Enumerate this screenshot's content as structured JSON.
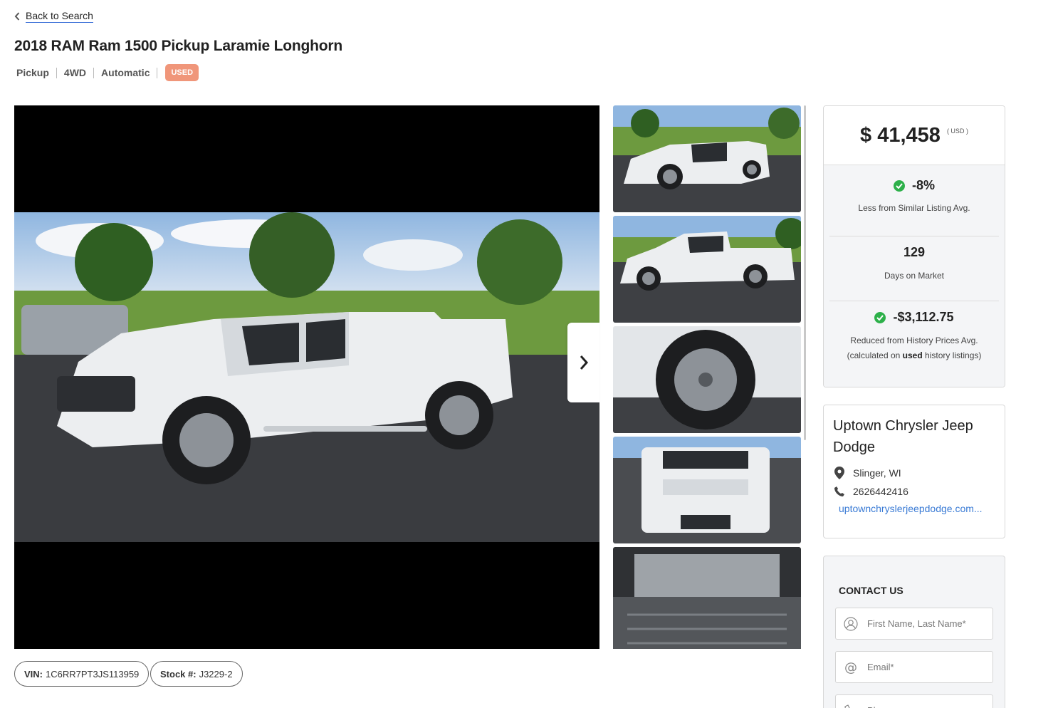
{
  "nav": {
    "back_label": "Back to Search"
  },
  "listing": {
    "title": "2018 RAM Ram 1500 Pickup Laramie Longhorn",
    "specs": [
      "Pickup",
      "4WD",
      "Automatic"
    ],
    "condition_badge": "USED",
    "vin_label": "VIN:",
    "vin": "1C6RR7PT3JS113959",
    "stock_label": "Stock #:",
    "stock": "J3229-2"
  },
  "gallery": {
    "main_photo": "white RAM 1500 pickup front three-quarter view on dealer lot",
    "thumbnails": [
      "white pickup front three-quarter view",
      "white pickup side profile view",
      "close-up of wheel and tire",
      "rear tailgate view with RAM lettering",
      "truck bed liner interior"
    ],
    "next_icon": "chevron-right-icon"
  },
  "pricing": {
    "price": "$ 41,458",
    "currency": "( USD )",
    "stat1_value": "-8%",
    "stat1_label": "Less from Similar Listing Avg.",
    "stat2_value": "129",
    "stat2_label": "Days on Market",
    "stat3_value": "-$3,112.75",
    "stat3_label": "Reduced from History Prices Avg.",
    "stat3_note_pre": "(calculated on",
    "stat3_note_bold": "used",
    "stat3_note_post": "history listings)"
  },
  "dealer": {
    "name": "Uptown Chrysler Jeep Dodge",
    "location": "Slinger, WI",
    "phone": "2626442416",
    "website": "uptownchryslerjeepdodge.com..."
  },
  "contact": {
    "title": "CONTACT US",
    "name_placeholder": "First Name, Last Name*",
    "email_placeholder": "Email*",
    "phone_placeholder": "Phone"
  },
  "colors": {
    "used_badge": "#f0967a",
    "check_green": "#2db04a",
    "link_blue": "#3a7bd5"
  }
}
